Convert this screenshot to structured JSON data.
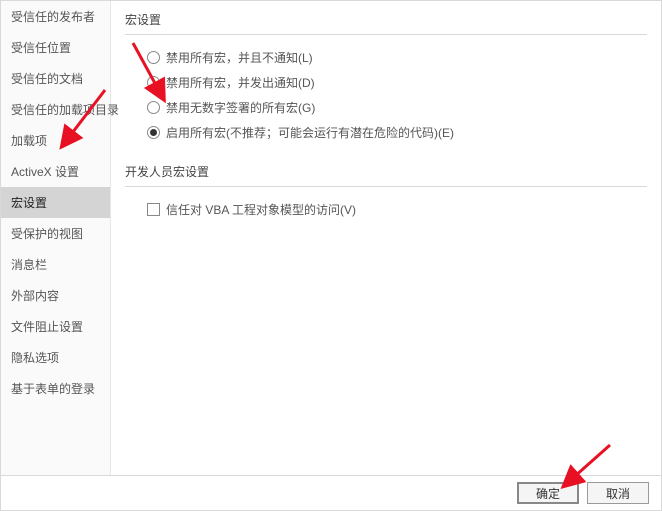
{
  "sidebar": {
    "items": [
      {
        "label": "受信任的发布者"
      },
      {
        "label": "受信任位置"
      },
      {
        "label": "受信任的文档"
      },
      {
        "label": "受信任的加载项目录"
      },
      {
        "label": "加载项"
      },
      {
        "label": "ActiveX 设置"
      },
      {
        "label": "宏设置"
      },
      {
        "label": "受保护的视图"
      },
      {
        "label": "消息栏"
      },
      {
        "label": "外部内容"
      },
      {
        "label": "文件阻止设置"
      },
      {
        "label": "隐私选项"
      },
      {
        "label": "基于表单的登录"
      }
    ],
    "selected_index": 6
  },
  "main": {
    "group1_title": "宏设置",
    "options": [
      {
        "label": "禁用所有宏，并且不通知(L)"
      },
      {
        "label": "禁用所有宏，并发出通知(D)"
      },
      {
        "label": "禁用无数字签署的所有宏(G)"
      },
      {
        "label": "启用所有宏(不推荐；可能会运行有潜在危险的代码)(E)"
      }
    ],
    "selected_option_index": 3,
    "group2_title": "开发人员宏设置",
    "checkbox_label": "信任对 VBA 工程对象模型的访问(V)",
    "checkbox_checked": false
  },
  "footer": {
    "ok_label": "确定",
    "cancel_label": "取消"
  }
}
